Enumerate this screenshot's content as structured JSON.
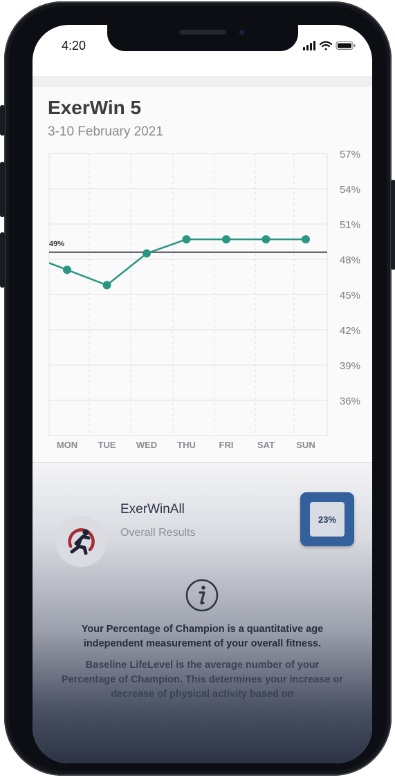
{
  "status_bar": {
    "time": "4:20"
  },
  "header": {
    "title": "ExerWin 5",
    "date_range": "3-10 February 2021"
  },
  "chart_data": {
    "type": "line",
    "categories": [
      "MON",
      "TUE",
      "WED",
      "THU",
      "FRI",
      "SAT",
      "SUN"
    ],
    "values": [
      47.1,
      45.8,
      48.5,
      49.7,
      49.7,
      49.7,
      49.7
    ],
    "y_tick_labels": [
      "57%",
      "54%",
      "51%",
      "48%",
      "45%",
      "42%",
      "39%",
      "36%"
    ],
    "ylim": [
      33,
      57
    ],
    "baseline": {
      "value": 48.6,
      "label": "49%"
    },
    "line_color": "#2a9683",
    "baseline_color": "#4a4a52",
    "grid": true
  },
  "summary": {
    "name": "ExerWinAll",
    "subtitle": "Overall Results",
    "percent": "23%",
    "badge_color": "#34609c"
  },
  "info": {
    "icon": "info-icon",
    "paragraph1": "Your Percentage of Champion is a quantitative age independent measurement of your overall fitness.",
    "paragraph2": "Baseline LifeLevel is the average number of your Percentage of Champion. This determines your increase or decrease of physical activity based on"
  }
}
